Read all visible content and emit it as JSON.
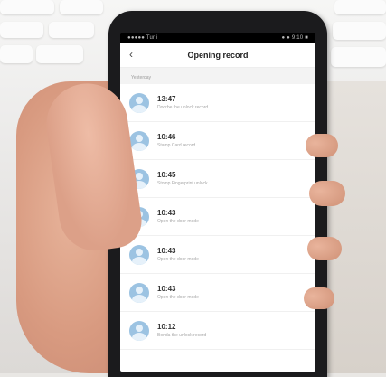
{
  "status_bar": {
    "carrier": "●●●●● Tuni",
    "right": "● ● 9:10 ■"
  },
  "header": {
    "back_icon": "chevron-left-icon",
    "title": "Opening record"
  },
  "section_label": "Yesterday",
  "records": [
    {
      "time": "13:47",
      "desc": "Doorbe the unlock record"
    },
    {
      "time": "10:46",
      "desc": "Stamp Card record"
    },
    {
      "time": "10:45",
      "desc": "Stomp Fingerprint unlock"
    },
    {
      "time": "10:43",
      "desc": "Open the door mode"
    },
    {
      "time": "10:43",
      "desc": "Open the door mode"
    },
    {
      "time": "10:43",
      "desc": "Open the door mode"
    },
    {
      "time": "10:12",
      "desc": "Bonda the unlock record"
    }
  ]
}
